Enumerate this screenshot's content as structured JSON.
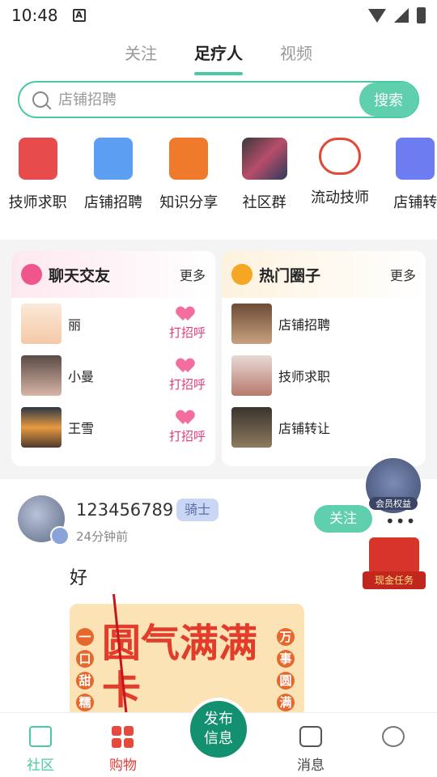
{
  "status_bar": {
    "time": "10:48",
    "notification_icon": "A"
  },
  "top_tabs": [
    {
      "label": "关注",
      "active": false
    },
    {
      "label": "足疗人",
      "active": true
    },
    {
      "label": "视频",
      "active": false
    }
  ],
  "search": {
    "placeholder": "店铺招聘",
    "button_label": "搜索"
  },
  "quick_entries": [
    {
      "label": "技师求职",
      "icon": "resume-icon",
      "color": "#e84b4b"
    },
    {
      "label": "店铺招聘",
      "icon": "document-icon",
      "color": "#5b9ef2"
    },
    {
      "label": "知识分享",
      "icon": "book-icon",
      "color": "#f07a2c"
    },
    {
      "label": "社区群",
      "icon": "group-thumbnail",
      "color": "#3a3a3a"
    },
    {
      "label": "流动技师",
      "icon": "people-icon",
      "color": "#e04a3a"
    },
    {
      "label": "店铺转",
      "icon": "store-icon",
      "color": "#6d7cf0"
    }
  ],
  "chat_card": {
    "title": "聊天交友",
    "more": "更多",
    "icon_color": "#f0568d",
    "users": [
      {
        "name": "丽",
        "action": "打招呼"
      },
      {
        "name": "小曼",
        "action": "打招呼"
      },
      {
        "name": "王雪",
        "action": "打招呼"
      }
    ]
  },
  "circle_card": {
    "title": "热门圈子",
    "more": "更多",
    "icon_color": "#f5a623",
    "items": [
      {
        "name": "店铺招聘"
      },
      {
        "name": "技师求职"
      },
      {
        "name": "店铺转让"
      }
    ]
  },
  "post": {
    "username": "123456789",
    "level": "骑士",
    "time": "24分钟前",
    "follow_label": "关注",
    "more": "•••",
    "text": "好",
    "image_text_main": "圆气满满卡",
    "image_text_left": [
      "一",
      "口",
      "甜",
      "糯"
    ],
    "image_text_right": [
      "万",
      "事",
      "圆",
      "满"
    ]
  },
  "floating": {
    "vip_label": "会员权益",
    "task_label": "现金任务"
  },
  "bottom_tabs": {
    "home": "社区",
    "shop": "购物",
    "publish": "发布信息",
    "messages": "消息",
    "me": ""
  },
  "colors": {
    "accent": "#49c9a6",
    "publish": "#13906f",
    "highlight_red": "#e53c35"
  }
}
